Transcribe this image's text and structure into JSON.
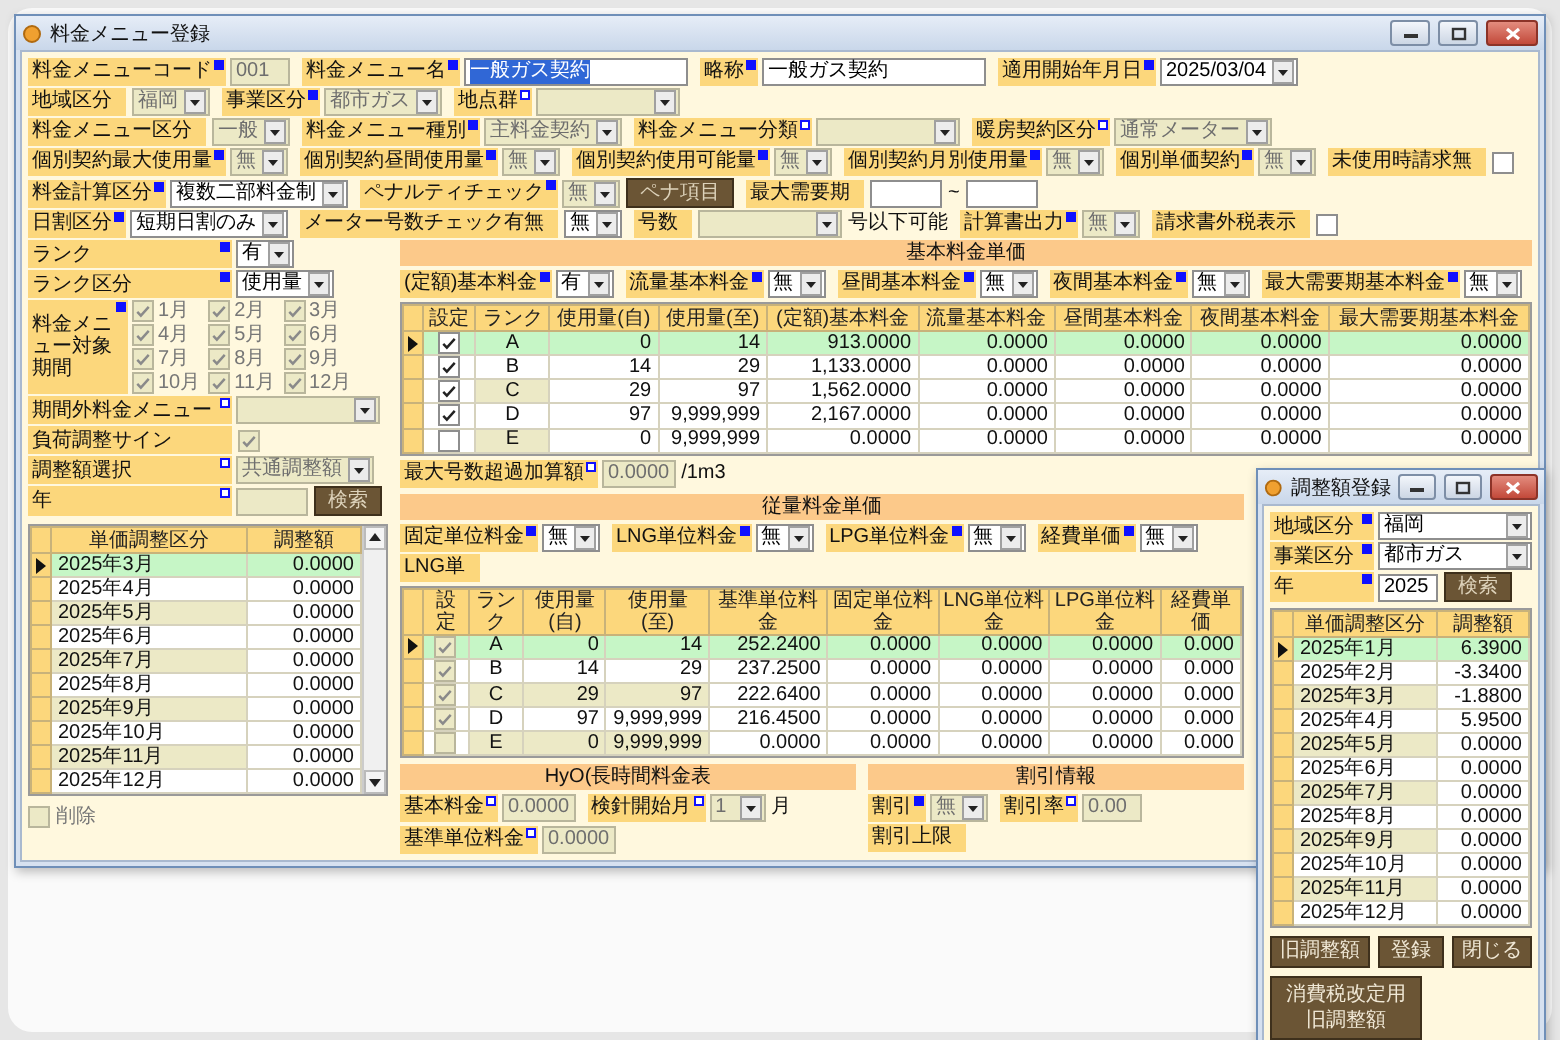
{
  "main_window": {
    "title": "料金メニュー登録",
    "form_rows": [
      [
        {
          "label": "料金メニューコード",
          "required": true,
          "controls": [
            {
              "kind": "text",
              "value": "001",
              "disabled": true,
              "text_selected": false
            }
          ]
        },
        {
          "label": "料金メニュー名",
          "required": true,
          "controls": [
            {
              "kind": "text",
              "value": "一般ガス契約",
              "disabled": false,
              "text_selected": true
            }
          ]
        },
        {
          "label": "略称",
          "required": true,
          "controls": [
            {
              "kind": "text",
              "value": "一般ガス契約",
              "disabled": false,
              "text_selected": false
            }
          ]
        },
        {
          "label": "適用開始年月日",
          "required": true,
          "controls": [
            {
              "kind": "select",
              "value": "2025/03/04",
              "disabled": false
            }
          ]
        }
      ],
      [
        {
          "label": "地域区分",
          "controls": [
            {
              "kind": "select",
              "value": "福岡",
              "disabled": true
            }
          ]
        },
        {
          "label": "事業区分",
          "required": true,
          "controls": [
            {
              "kind": "select",
              "value": "都市ガス",
              "disabled": true
            }
          ]
        },
        {
          "label": "地点群",
          "required": false,
          "controls": [
            {
              "kind": "select",
              "disabled": true
            }
          ]
        }
      ],
      [
        {
          "label": "料金メニュー区分",
          "controls": [
            {
              "kind": "select",
              "value": "一般",
              "disabled": true
            }
          ]
        },
        {
          "label": "料金メニュー種別",
          "required": true,
          "controls": [
            {
              "kind": "select",
              "value": "主料金契約",
              "disabled": true
            }
          ]
        },
        {
          "label": "料金メニュー分類",
          "required": false,
          "controls": [
            {
              "kind": "select",
              "disabled": true
            }
          ]
        },
        {
          "label": "暖房契約区分",
          "required": false,
          "controls": [
            {
              "kind": "select",
              "value": "通常メーター",
              "disabled": true
            }
          ]
        }
      ],
      [
        {
          "label": "個別契約最大使用量",
          "required": true,
          "controls": [
            {
              "kind": "select",
              "value": "無",
              "disabled": true
            }
          ]
        },
        {
          "label": "個別契約昼間使用量",
          "required": true,
          "controls": [
            {
              "kind": "select",
              "value": "無",
              "disabled": true
            }
          ]
        },
        {
          "label": "個別契約使用可能量",
          "required": true,
          "controls": [
            {
              "kind": "select",
              "value": "無",
              "disabled": true
            }
          ]
        },
        {
          "label": "個別契約月別使用量",
          "required": true,
          "controls": [
            {
              "kind": "select",
              "value": "無",
              "disabled": true
            }
          ]
        },
        {
          "label": "個別単価契約",
          "required": true,
          "controls": [
            {
              "kind": "select",
              "value": "無",
              "disabled": true
            }
          ]
        },
        {
          "label": "未使用時請求無",
          "controls": [
            {
              "kind": "check",
              "checked": false,
              "disabled": false
            }
          ]
        }
      ],
      [
        {
          "label": "料金計算区分",
          "required": true,
          "controls": [
            {
              "kind": "select",
              "value": "複数二部料金制",
              "disabled": false
            }
          ]
        },
        {
          "label": "ペナルティチェック",
          "required": true,
          "controls": [
            {
              "kind": "select",
              "value": "無",
              "disabled": true
            },
            {
              "kind": "button",
              "text": "ペナ項目"
            }
          ]
        },
        {
          "label": "最大需要期",
          "controls": [
            {
              "kind": "text",
              "disabled": false
            },
            {
              "kind": "sep",
              "text": "~"
            },
            {
              "kind": "text",
              "disabled": false
            }
          ]
        }
      ],
      [
        {
          "label": "日割区分",
          "required": true,
          "controls": [
            {
              "kind": "select",
              "value": "短期日割のみ",
              "disabled": false
            }
          ]
        },
        {
          "label": "メーター号数チェック有無",
          "controls": [
            {
              "kind": "select",
              "value": "無",
              "disabled": false
            }
          ]
        },
        {
          "label": "号数",
          "controls": [
            {
              "kind": "select",
              "disabled": true
            },
            {
              "kind": "sep",
              "text": "号以下可能"
            }
          ]
        },
        {
          "label": "計算書出力",
          "required": true,
          "controls": [
            {
              "kind": "select",
              "value": "無",
              "disabled": true
            }
          ]
        },
        {
          "label": "請求書外税表示",
          "controls": [
            {
              "kind": "check",
              "checked": false,
              "disabled": false
            }
          ]
        }
      ]
    ],
    "left_fields": [
      {
        "label": "ランク",
        "required": true,
        "controls": [
          {
            "kind": "select",
            "value": "有",
            "disabled": false
          }
        ]
      },
      {
        "label": "ランク区分",
        "required": true,
        "controls": [
          {
            "kind": "select",
            "value": "使用量",
            "disabled": false
          }
        ]
      },
      {
        "label": "料金メニュー対象期間",
        "required": true,
        "controls": [
          {
            "kind": "months",
            "disabled": true,
            "months": [
              {
                "label": "1月",
                "checked": true
              },
              {
                "label": "2月",
                "checked": true
              },
              {
                "label": "3月",
                "checked": true
              },
              {
                "label": "4月",
                "checked": true
              },
              {
                "label": "5月",
                "checked": true
              },
              {
                "label": "6月",
                "checked": true
              },
              {
                "label": "7月",
                "checked": true
              },
              {
                "label": "8月",
                "checked": true
              },
              {
                "label": "9月",
                "checked": true
              },
              {
                "label": "10月",
                "checked": true
              },
              {
                "label": "11月",
                "checked": true
              },
              {
                "label": "12月",
                "checked": true
              }
            ]
          }
        ]
      },
      {
        "label": "期間外料金メニュー",
        "required": false,
        "controls": [
          {
            "kind": "select",
            "disabled": true
          }
        ]
      },
      {
        "label": "負荷調整サイン",
        "controls": [
          {
            "kind": "check",
            "checked": true,
            "disabled": true
          }
        ]
      },
      {
        "label": "調整額選択",
        "required": false,
        "controls": [
          {
            "kind": "select",
            "value": "共通調整額",
            "disabled": true
          }
        ]
      },
      {
        "label": "年",
        "required": false,
        "controls": [
          {
            "kind": "text",
            "disabled": true
          },
          {
            "kind": "button",
            "text": "検索"
          }
        ]
      }
    ],
    "adjustment_grid": {
      "columns": [
        "単価調整区分",
        "調整額"
      ],
      "rows": [
        {
          "selected": true,
          "cells": [
            "2025年3月",
            "0.0000"
          ]
        },
        {
          "selected": false,
          "cells": [
            "2025年4月",
            "0.0000"
          ]
        },
        {
          "selected": false,
          "cells": [
            "2025年5月",
            "0.0000"
          ]
        },
        {
          "selected": false,
          "cells": [
            "2025年6月",
            "0.0000"
          ]
        },
        {
          "selected": false,
          "cells": [
            "2025年7月",
            "0.0000"
          ]
        },
        {
          "selected": false,
          "cells": [
            "2025年8月",
            "0.0000"
          ]
        },
        {
          "selected": false,
          "cells": [
            "2025年9月",
            "0.0000"
          ]
        },
        {
          "selected": false,
          "cells": [
            "2025年10月",
            "0.0000"
          ]
        },
        {
          "selected": false,
          "cells": [
            "2025年11月",
            "0.0000"
          ]
        },
        {
          "selected": false,
          "cells": [
            "2025年12月",
            "0.0000"
          ]
        }
      ]
    },
    "delete_option": {
      "label": "削除",
      "checked": false,
      "disabled": true
    },
    "basic_rates": {
      "title": "基本料金単価",
      "selectors": [
        {
          "label": "(定額)基本料金",
          "required": true,
          "controls": [
            {
              "kind": "select",
              "value": "有",
              "disabled": false
            }
          ]
        },
        {
          "label": "流量基本料金",
          "required": true,
          "controls": [
            {
              "kind": "select",
              "value": "無",
              "disabled": false
            }
          ]
        },
        {
          "label": "昼間基本料金",
          "required": true,
          "controls": [
            {
              "kind": "select",
              "value": "無",
              "disabled": false
            }
          ]
        },
        {
          "label": "夜間基本料金",
          "required": true,
          "controls": [
            {
              "kind": "select",
              "value": "無",
              "disabled": false
            }
          ]
        },
        {
          "label": "最大需要期基本料金",
          "required": true,
          "controls": [
            {
              "kind": "select",
              "value": "無",
              "disabled": false
            }
          ]
        }
      ],
      "table": {
        "columns": [
          "設定",
          "ランク",
          "使用量(自)",
          "使用量(至)",
          "(定額)基本料金",
          "流量基本料金",
          "昼間基本料金",
          "夜間基本料金",
          "最大需要期基本料金"
        ],
        "checks_disabled": false,
        "rows": [
          {
            "selected": true,
            "cells": [
              {
                "checked": true
              },
              "A",
              "0",
              "14",
              "913.0000",
              "0.0000",
              "0.0000",
              "0.0000",
              "0.0000"
            ]
          },
          {
            "selected": false,
            "cells": [
              {
                "checked": true
              },
              "B",
              "14",
              "29",
              "1,133.0000",
              "0.0000",
              "0.0000",
              "0.0000",
              "0.0000"
            ]
          },
          {
            "selected": false,
            "cells": [
              {
                "checked": true
              },
              "C",
              "29",
              "97",
              "1,562.0000",
              "0.0000",
              "0.0000",
              "0.0000",
              "0.0000"
            ]
          },
          {
            "selected": false,
            "cells": [
              {
                "checked": true
              },
              "D",
              "97",
              "9,999,999",
              "2,167.0000",
              "0.0000",
              "0.0000",
              "0.0000",
              "0.0000"
            ]
          },
          {
            "selected": false,
            "cells": [
              {
                "checked": false
              },
              "E",
              "0",
              "9,999,999",
              "0.0000",
              "0.0000",
              "0.0000",
              "0.0000",
              "0.0000"
            ]
          }
        ]
      },
      "extra": [
        {
          "label": "最大号数超過加算額",
          "required": false,
          "controls": [
            {
              "kind": "text",
              "value": "0.0000",
              "disabled": true
            },
            {
              "kind": "sep",
              "text": "/1m3"
            }
          ]
        }
      ]
    },
    "meter_rates": {
      "title": "従量料金単価",
      "selectors": [
        {
          "label": "固定単位料金",
          "required": true,
          "controls": [
            {
              "kind": "select",
              "value": "無",
              "disabled": false
            }
          ]
        },
        {
          "label": "LNG単位料金",
          "required": true,
          "controls": [
            {
              "kind": "select",
              "value": "無",
              "disabled": false
            }
          ]
        },
        {
          "label": "LPG単位料金",
          "required": true,
          "controls": [
            {
              "kind": "select",
              "value": "無",
              "disabled": false
            }
          ]
        },
        {
          "label": "経費単価",
          "required": true,
          "controls": [
            {
              "kind": "select",
              "value": "無",
              "disabled": false
            }
          ]
        },
        {
          "label": "LNG単"
        }
      ],
      "table": {
        "columns": [
          "設定",
          "ランク",
          "使用量(自)",
          "使用量(至)",
          "基準単位料金",
          "固定単位料金",
          "LNG単位料金",
          "LPG単位料金",
          "経費単価"
        ],
        "checks_disabled": true,
        "rows": [
          {
            "selected": true,
            "cells": [
              {
                "checked": true
              },
              "A",
              "0",
              "14",
              "252.2400",
              "0.0000",
              "0.0000",
              "0.0000",
              "0.000"
            ]
          },
          {
            "selected": false,
            "cells": [
              {
                "checked": true
              },
              "B",
              "14",
              "29",
              "237.2500",
              "0.0000",
              "0.0000",
              "0.0000",
              "0.000"
            ]
          },
          {
            "selected": false,
            "cells": [
              {
                "checked": true
              },
              "C",
              "29",
              "97",
              "222.6400",
              "0.0000",
              "0.0000",
              "0.0000",
              "0.000"
            ]
          },
          {
            "selected": false,
            "cells": [
              {
                "checked": true
              },
              "D",
              "97",
              "9,999,999",
              "216.4500",
              "0.0000",
              "0.0000",
              "0.0000",
              "0.000"
            ]
          },
          {
            "selected": false,
            "cells": [
              {
                "checked": false
              },
              "E",
              "0",
              "9,999,999",
              "0.0000",
              "0.0000",
              "0.0000",
              "0.0000",
              "0.000"
            ]
          }
        ]
      }
    },
    "hyo_rates": {
      "title": "HyO(長時間料金表",
      "rows": [
        [
          {
            "label": "基本料金",
            "required": false,
            "controls": [
              {
                "kind": "text",
                "value": "0.0000",
                "disabled": true
              }
            ]
          },
          {
            "label": "検針開始月",
            "required": false,
            "controls": [
              {
                "kind": "select",
                "value": "1",
                "disabled": true
              },
              {
                "kind": "sep",
                "text": "月"
              }
            ]
          }
        ],
        [
          {
            "label": "基準単位料金",
            "required": false,
            "controls": [
              {
                "kind": "text",
                "value": "0.0000",
                "disabled": true
              }
            ]
          }
        ]
      ]
    },
    "discount": {
      "title": "割引情報",
      "rows": [
        [
          {
            "label": "割引",
            "required": true,
            "controls": [
              {
                "kind": "select",
                "value": "無",
                "disabled": true
              }
            ]
          },
          {
            "label": "割引率",
            "required": false,
            "controls": [
              {
                "kind": "text",
                "value": "0.00",
                "disabled": true
              }
            ]
          },
          {
            "label": "割引上限"
          }
        ]
      ]
    }
  },
  "adjustment_window": {
    "title": "調整額登録",
    "fields": [
      {
        "label": "地域区分",
        "required": true,
        "controls": [
          {
            "kind": "select",
            "value": "福岡",
            "disabled": false
          }
        ]
      },
      {
        "label": "事業区分",
        "required": true,
        "controls": [
          {
            "kind": "select",
            "value": "都市ガス",
            "disabled": false
          }
        ]
      },
      {
        "label": "年",
        "required": true,
        "controls": [
          {
            "kind": "text",
            "value": "2025",
            "disabled": false
          },
          {
            "kind": "button",
            "text": "検索"
          }
        ]
      }
    ],
    "grid": {
      "columns": [
        "単価調整区分",
        "調整額"
      ],
      "rows": [
        {
          "selected": true,
          "cells": [
            "2025年1月",
            "6.3900"
          ]
        },
        {
          "selected": false,
          "cells": [
            "2025年2月",
            "-3.3400"
          ]
        },
        {
          "selected": false,
          "cells": [
            "2025年3月",
            "-1.8800"
          ]
        },
        {
          "selected": false,
          "cells": [
            "2025年4月",
            "5.9500"
          ]
        },
        {
          "selected": false,
          "cells": [
            "2025年5月",
            "0.0000"
          ]
        },
        {
          "selected": false,
          "cells": [
            "2025年6月",
            "0.0000"
          ]
        },
        {
          "selected": false,
          "cells": [
            "2025年7月",
            "0.0000"
          ]
        },
        {
          "selected": false,
          "cells": [
            "2025年8月",
            "0.0000"
          ]
        },
        {
          "selected": false,
          "cells": [
            "2025年9月",
            "0.0000"
          ]
        },
        {
          "selected": false,
          "cells": [
            "2025年10月",
            "0.0000"
          ]
        },
        {
          "selected": false,
          "cells": [
            "2025年11月",
            "0.0000"
          ]
        },
        {
          "selected": false,
          "cells": [
            "2025年12月",
            "0.0000"
          ]
        }
      ]
    },
    "buttons": [
      "旧調整額",
      "登録",
      "閉じる",
      "消費税改定用旧調整額"
    ]
  }
}
